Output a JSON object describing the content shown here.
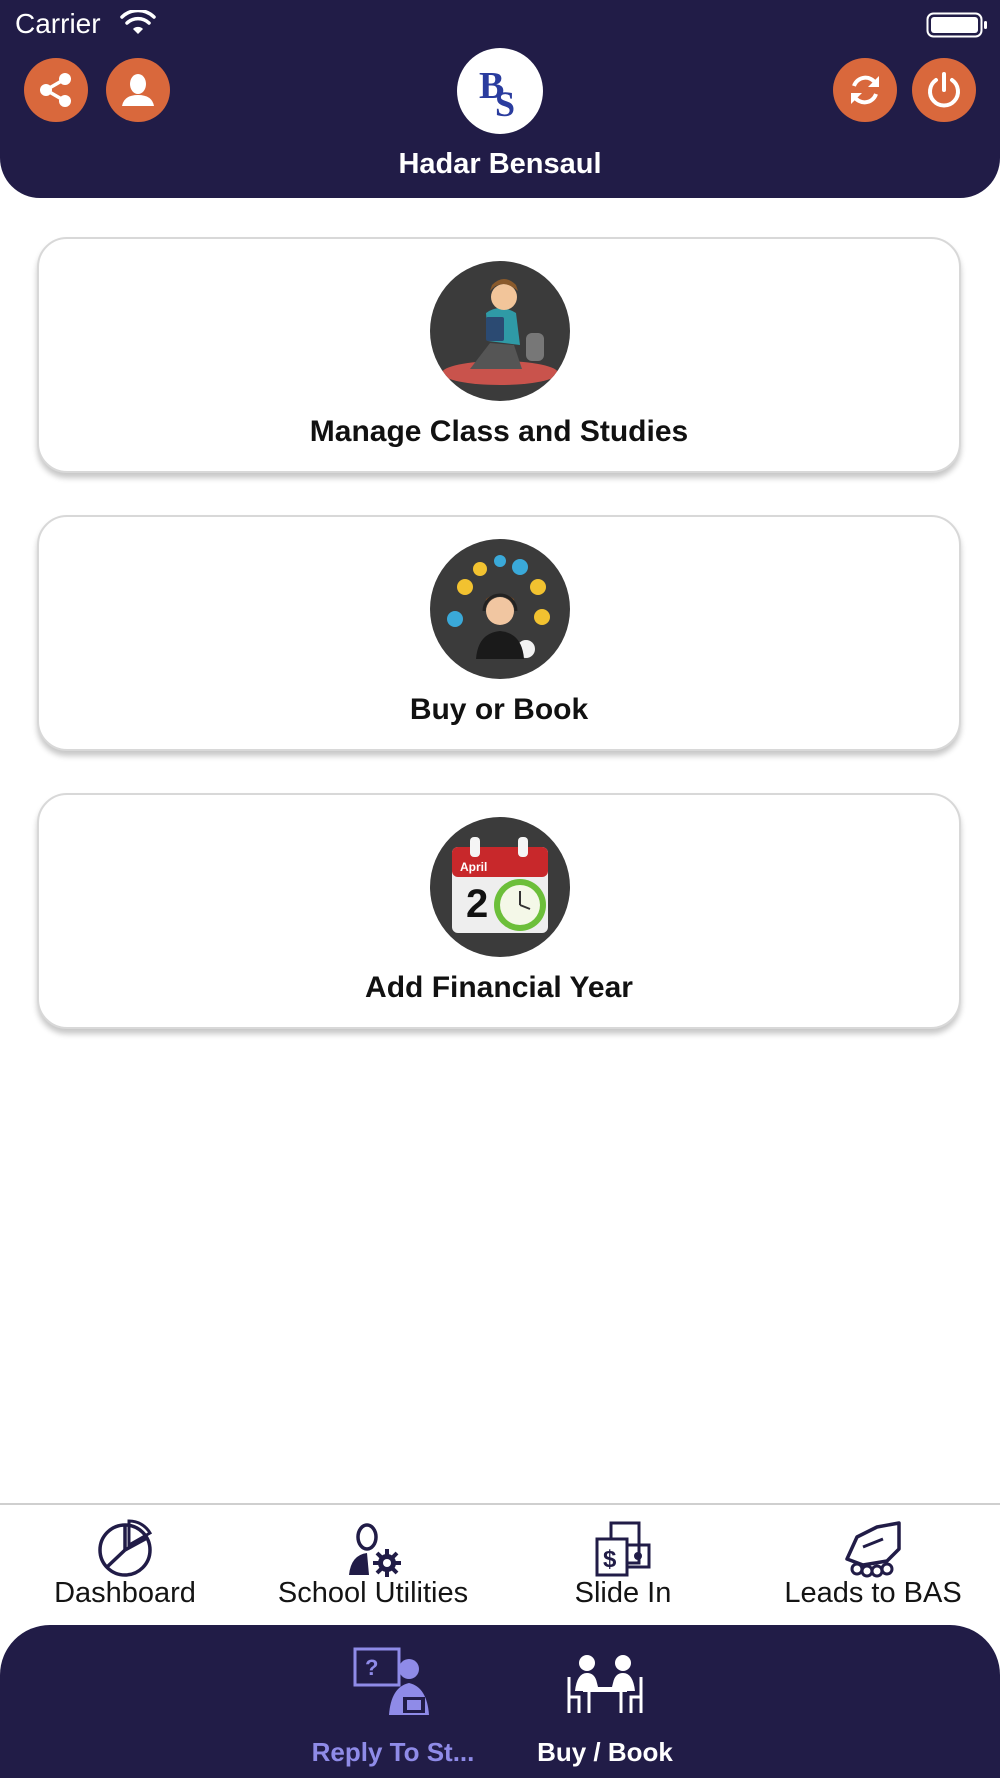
{
  "status_bar": {
    "carrier": "Carrier",
    "wifi_icon": "wifi-icon",
    "battery_icon": "battery-icon"
  },
  "header": {
    "user_name": "Hadar Bensaul",
    "logo_text": "BS",
    "left_buttons": [
      "share-icon",
      "profile-icon"
    ],
    "right_buttons": [
      "refresh-icon",
      "power-icon"
    ],
    "accent_color": "#d9683c",
    "bar_color": "#211c47"
  },
  "cards": [
    {
      "label": "Manage Class and Studies",
      "icon": "student-reading-icon"
    },
    {
      "label": "Buy or Book",
      "icon": "support-agent-icon"
    },
    {
      "label": "Add Financial Year",
      "icon": "calendar-clock-icon",
      "icon_month": "April",
      "icon_day": "2"
    }
  ],
  "tabbar": {
    "items": [
      {
        "label": "Dashboard",
        "icon": "pie-chart-icon"
      },
      {
        "label": "School Utilities",
        "icon": "user-gear-icon"
      },
      {
        "label": "Slide In",
        "icon": "money-receipt-icon"
      },
      {
        "label": "Leads to BAS",
        "icon": "handshake-icon"
      }
    ]
  },
  "dock": {
    "items": [
      {
        "label": "Reply To St...",
        "icon": "teacher-board-icon",
        "active": true,
        "color": "#8f8be8"
      },
      {
        "label": "Buy / Book",
        "icon": "meeting-table-icon",
        "active": false,
        "color": "#ffffff"
      }
    ]
  }
}
